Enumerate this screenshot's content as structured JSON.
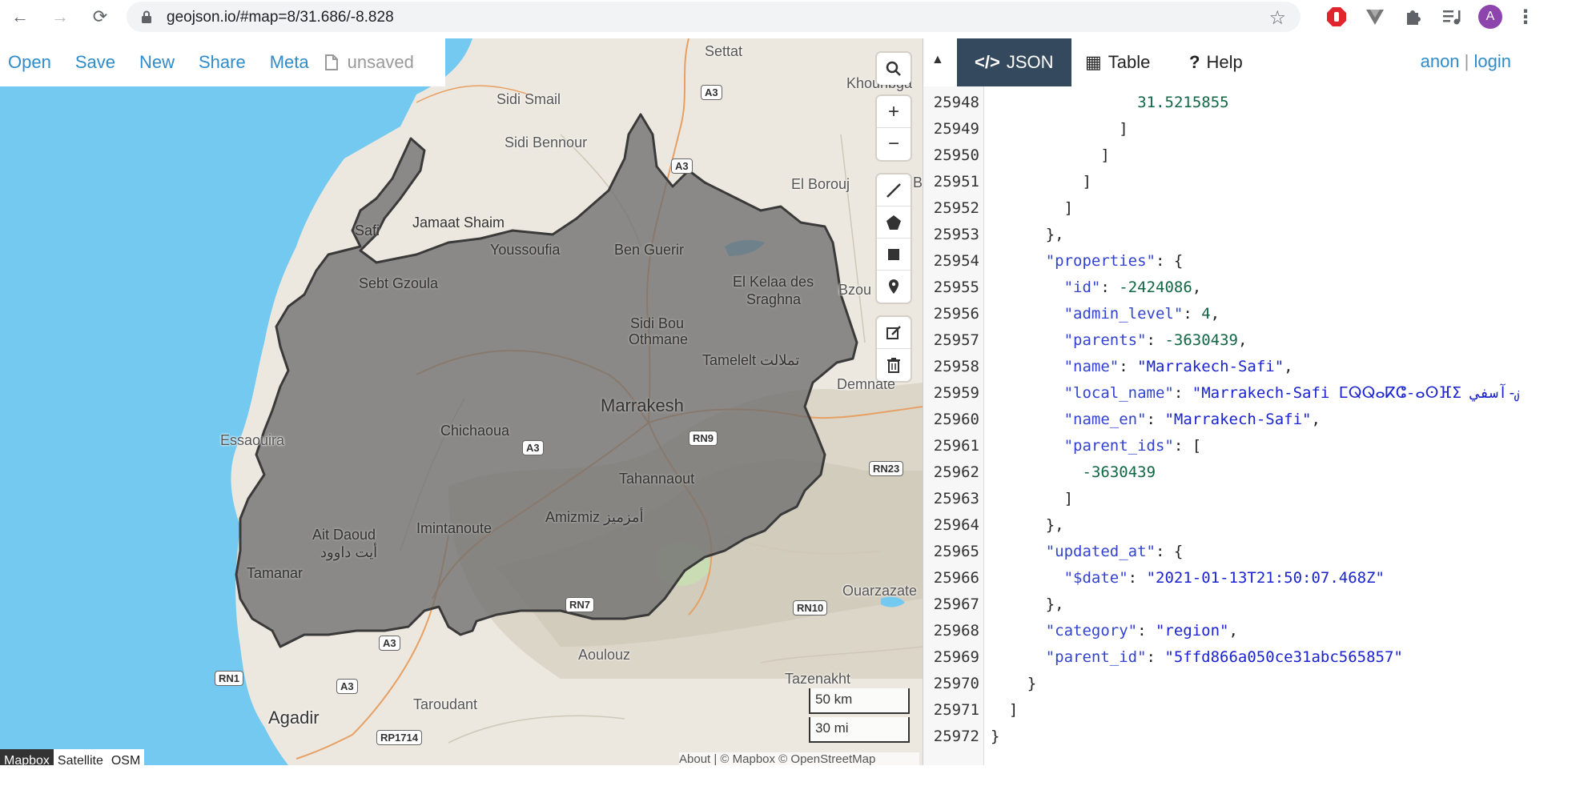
{
  "browser": {
    "url": "geojson.io/#map=8/31.686/-8.828",
    "avatar_letter": "A",
    "nav": {
      "back": "←",
      "forward": "→",
      "reload": "⟳"
    },
    "star": "☆"
  },
  "menu": {
    "items": [
      "Open",
      "Save",
      "New",
      "Share",
      "Meta"
    ],
    "unsaved_label": "unsaved"
  },
  "map": {
    "towns": [
      {
        "name": "Settat"
      },
      {
        "name": "Sidi Smail"
      },
      {
        "name": "Khouribga"
      },
      {
        "name": "Sidi Bennour"
      },
      {
        "name": "El Borouj"
      },
      {
        "name": "Safi"
      },
      {
        "name": "Jamaat Shaim"
      },
      {
        "name": "Youssoufia"
      },
      {
        "name": "Ben Guerir"
      },
      {
        "name": "Sebt Gzoula"
      },
      {
        "name": "El Kelaa des"
      },
      {
        "name": "Sraghna"
      },
      {
        "name": "Bzou"
      },
      {
        "name": "Sidi Bou"
      },
      {
        "name": "Othmane"
      },
      {
        "name": "Tamelelt تملالت"
      },
      {
        "name": "Demnate"
      },
      {
        "name": "Marrakesh"
      },
      {
        "name": "Essaouira"
      },
      {
        "name": "Chichaoua"
      },
      {
        "name": "Tahannaout"
      },
      {
        "name": "Amizmiz أمزميز"
      },
      {
        "name": "Ait Daoud"
      },
      {
        "name": "أيت داوود"
      },
      {
        "name": "Imintanoute"
      },
      {
        "name": "Tamanar"
      },
      {
        "name": "Ouarzazate"
      },
      {
        "name": "Aoulouz"
      },
      {
        "name": "Tazenakht"
      },
      {
        "name": "Taroudant"
      },
      {
        "name": "Agadir"
      },
      {
        "name": "B"
      }
    ],
    "roads": [
      "A3",
      "A3",
      "A3",
      "RN9",
      "RN23",
      "RN7",
      "RN10",
      "A3",
      "RN1",
      "A3",
      "RP1714"
    ],
    "scale_km": "50 km",
    "scale_mi": "30 mi",
    "layers": [
      "Mapbox",
      "Satellite",
      "OSM"
    ],
    "attribution": "About | © Mapbox © OpenStreetMap"
  },
  "pane": {
    "tabs": [
      {
        "icon": "</>",
        "label": "JSON"
      },
      {
        "icon": "▦",
        "label": "Table"
      },
      {
        "icon": "?",
        "label": "Help"
      }
    ],
    "user": {
      "name": "anon",
      "sep": "|",
      "login": "login"
    },
    "collapse": "▲"
  },
  "code_lines": [
    {
      "n": "25948",
      "indent": 16,
      "parts": [
        [
          "n",
          "31.5215855"
        ]
      ]
    },
    {
      "n": "25949",
      "indent": 14,
      "parts": [
        [
          "p",
          "]"
        ]
      ]
    },
    {
      "n": "25950",
      "indent": 12,
      "parts": [
        [
          "p",
          "]"
        ]
      ]
    },
    {
      "n": "25951",
      "indent": 10,
      "parts": [
        [
          "p",
          "]"
        ]
      ]
    },
    {
      "n": "25952",
      "indent": 8,
      "parts": [
        [
          "p",
          "]"
        ]
      ]
    },
    {
      "n": "25953",
      "indent": 6,
      "parts": [
        [
          "p",
          "},"
        ]
      ]
    },
    {
      "n": "25954",
      "indent": 6,
      "parts": [
        [
          "k",
          "\"properties\""
        ],
        [
          "p",
          ": {"
        ]
      ]
    },
    {
      "n": "25955",
      "indent": 8,
      "parts": [
        [
          "k",
          "\"id\""
        ],
        [
          "p",
          ": "
        ],
        [
          "n",
          "-2424086"
        ],
        [
          "p",
          ","
        ]
      ]
    },
    {
      "n": "25956",
      "indent": 8,
      "parts": [
        [
          "k",
          "\"admin_level\""
        ],
        [
          "p",
          ": "
        ],
        [
          "n",
          "4"
        ],
        [
          "p",
          ","
        ]
      ]
    },
    {
      "n": "25957",
      "indent": 8,
      "parts": [
        [
          "k",
          "\"parents\""
        ],
        [
          "p",
          ": "
        ],
        [
          "n",
          "-3630439"
        ],
        [
          "p",
          ","
        ]
      ]
    },
    {
      "n": "25958",
      "indent": 8,
      "parts": [
        [
          "k",
          "\"name\""
        ],
        [
          "p",
          ": "
        ],
        [
          "s",
          "\"Marrakech-Safi\""
        ],
        [
          "p",
          ","
        ]
      ]
    },
    {
      "n": "25959",
      "indent": 8,
      "parts": [
        [
          "k",
          "\"local_name\""
        ],
        [
          "p",
          ": "
        ],
        [
          "s",
          "\"Marrakech-Safi ⵎⵕⵕⴰⴽⵛ-ⴰⵙⴼⵉ مراكش-آسفي\""
        ]
      ]
    },
    {
      "n": "25960",
      "indent": 8,
      "parts": [
        [
          "k",
          "\"name_en\""
        ],
        [
          "p",
          ": "
        ],
        [
          "s",
          "\"Marrakech-Safi\""
        ],
        [
          "p",
          ","
        ]
      ]
    },
    {
      "n": "25961",
      "indent": 8,
      "parts": [
        [
          "k",
          "\"parent_ids\""
        ],
        [
          "p",
          ": ["
        ]
      ]
    },
    {
      "n": "25962",
      "indent": 10,
      "parts": [
        [
          "n",
          "-3630439"
        ]
      ]
    },
    {
      "n": "25963",
      "indent": 8,
      "parts": [
        [
          "p",
          "]"
        ]
      ]
    },
    {
      "n": "25964",
      "indent": 6,
      "parts": [
        [
          "p",
          "},"
        ]
      ]
    },
    {
      "n": "25965",
      "indent": 6,
      "parts": [
        [
          "k",
          "\"updated_at\""
        ],
        [
          "p",
          ": {"
        ]
      ]
    },
    {
      "n": "25966",
      "indent": 8,
      "parts": [
        [
          "k",
          "\"$date\""
        ],
        [
          "p",
          ": "
        ],
        [
          "s",
          "\"2021-01-13T21:50:07.468Z\""
        ]
      ]
    },
    {
      "n": "25967",
      "indent": 6,
      "parts": [
        [
          "p",
          "},"
        ]
      ]
    },
    {
      "n": "25968",
      "indent": 6,
      "parts": [
        [
          "k",
          "\"category\""
        ],
        [
          "p",
          ": "
        ],
        [
          "s",
          "\"region\""
        ],
        [
          "p",
          ","
        ]
      ]
    },
    {
      "n": "25969",
      "indent": 6,
      "parts": [
        [
          "k",
          "\"parent_id\""
        ],
        [
          "p",
          ": "
        ],
        [
          "s",
          "\"5ffd866a050ce31abc565857\""
        ]
      ]
    },
    {
      "n": "25970",
      "indent": 4,
      "parts": [
        [
          "p",
          "}"
        ]
      ]
    },
    {
      "n": "25971",
      "indent": 2,
      "parts": [
        [
          "p",
          "]"
        ]
      ]
    },
    {
      "n": "25972",
      "indent": 0,
      "parts": [
        [
          "p",
          "}"
        ]
      ]
    }
  ],
  "colors": {
    "ocean": "#73c9ef",
    "land": "#ece8df",
    "region_fill": "#7c7c7c",
    "region_stroke": "#3a3a3a",
    "link": "#2f8bc9",
    "tab_active": "#34495e",
    "json_key": "#3343cf",
    "json_number": "#116644"
  }
}
